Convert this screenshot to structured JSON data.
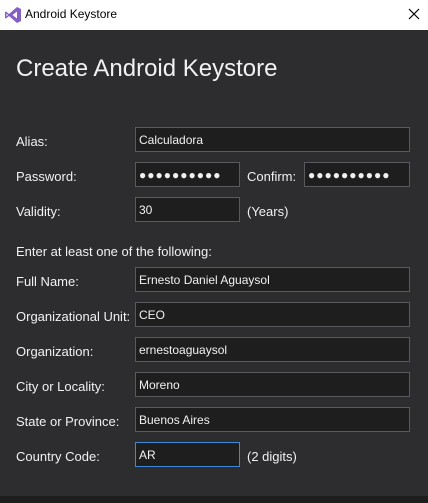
{
  "window": {
    "title": "Android Keystore",
    "icon": "visual-studio-icon",
    "close_icon": "close-icon"
  },
  "form": {
    "heading": "Create Android Keystore",
    "alias": {
      "label": "Alias:",
      "value": "Calculadora"
    },
    "password": {
      "label": "Password:",
      "value": "●●●●●●●●●●"
    },
    "confirm": {
      "label": "Confirm:",
      "value": "●●●●●●●●●●"
    },
    "validity": {
      "label": "Validity:",
      "value": "30",
      "unit": "(Years)"
    },
    "instruction": "Enter at least one of the following:",
    "full_name": {
      "label": "Full Name:",
      "value": "Ernesto Daniel Aguaysol"
    },
    "org_unit": {
      "label": "Organizational Unit:",
      "value": "CEO"
    },
    "organization": {
      "label": "Organization:",
      "value": "ernestoaguaysol"
    },
    "city": {
      "label": "City or Locality:",
      "value": "Moreno"
    },
    "state": {
      "label": "State or Province:",
      "value": "Buenos Aires"
    },
    "country": {
      "label": "Country Code:",
      "value": "AR",
      "hint": "(2 digits)"
    }
  },
  "colors": {
    "background": "#2d2d30",
    "field_background": "#1e1e1e",
    "field_border": "#5a5a5e",
    "focus_border": "#3c8ad6",
    "text": "#f1f1f1",
    "brand": "#865fc5"
  }
}
